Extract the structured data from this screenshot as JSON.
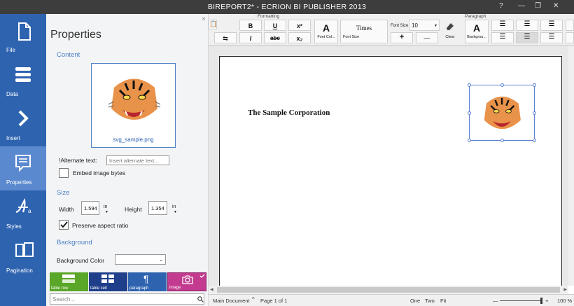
{
  "window": {
    "title": "BIREPORT2* - ECRION BI PUBLISHER 2013",
    "help": "?",
    "minimize": "—",
    "restore": "❐",
    "close": "✕"
  },
  "nav": [
    {
      "label": "File",
      "icon": "file-icon"
    },
    {
      "label": "Data",
      "icon": "data-icon"
    },
    {
      "label": "Insert",
      "icon": "insert-icon"
    },
    {
      "label": "Properties",
      "icon": "properties-icon",
      "active": true
    },
    {
      "label": "Styles",
      "icon": "styles-icon"
    },
    {
      "label": "Pagination",
      "icon": "pagination-icon"
    }
  ],
  "properties": {
    "title": "Properties",
    "close": "×",
    "content_heading": "Content",
    "image_name": "svg_sample.png",
    "alt_label": "!Alternate text:",
    "alt_placeholder": "Insert alternate text...",
    "embed_label": "Embed image bytes",
    "embed_checked": false,
    "size_heading": "Size",
    "width_label": "Width",
    "width_value": "1.594",
    "width_unit": "in",
    "height_label": "Height",
    "height_value": "1.354",
    "height_unit": "in",
    "aspect_label": "Preserve aspect ratio",
    "aspect_checked": true,
    "background_heading": "Background",
    "bgcolor_label": "Background Color",
    "tiles": [
      {
        "label": "table row",
        "color": "#5aa628"
      },
      {
        "label": "table cell",
        "color": "#1f3f8a"
      },
      {
        "label": "paragraph",
        "color": "#2e63b0"
      },
      {
        "label": "image",
        "color": "#c23b8f"
      }
    ],
    "search_placeholder": "Search..."
  },
  "ribbon": {
    "formatting_label": "Formatting",
    "paragraph_label": "Paragraph",
    "bold": "B",
    "underline": "U",
    "superscript": "x²",
    "italic": "I",
    "strike": "abc",
    "subscript": "x₂",
    "format_painter": "⇆",
    "font_color_label": "Font Col...",
    "font_color_glyph": "A",
    "font_name": "Times",
    "font_name_label": "Font Size",
    "font_size_label": "Font Size",
    "font_size": "10",
    "grow": "+",
    "shrink": "—",
    "clear_label": "Clear",
    "background_label": "Backgrou...",
    "background_glyph": "A"
  },
  "document": {
    "heading": "The Sample Corporation"
  },
  "status": {
    "main_document": "Main Document",
    "page": "Page 1 of 1",
    "one": "One",
    "two": "Two",
    "fit": "Fit",
    "minus": "—",
    "plus": "+",
    "zoom": "100 %"
  }
}
